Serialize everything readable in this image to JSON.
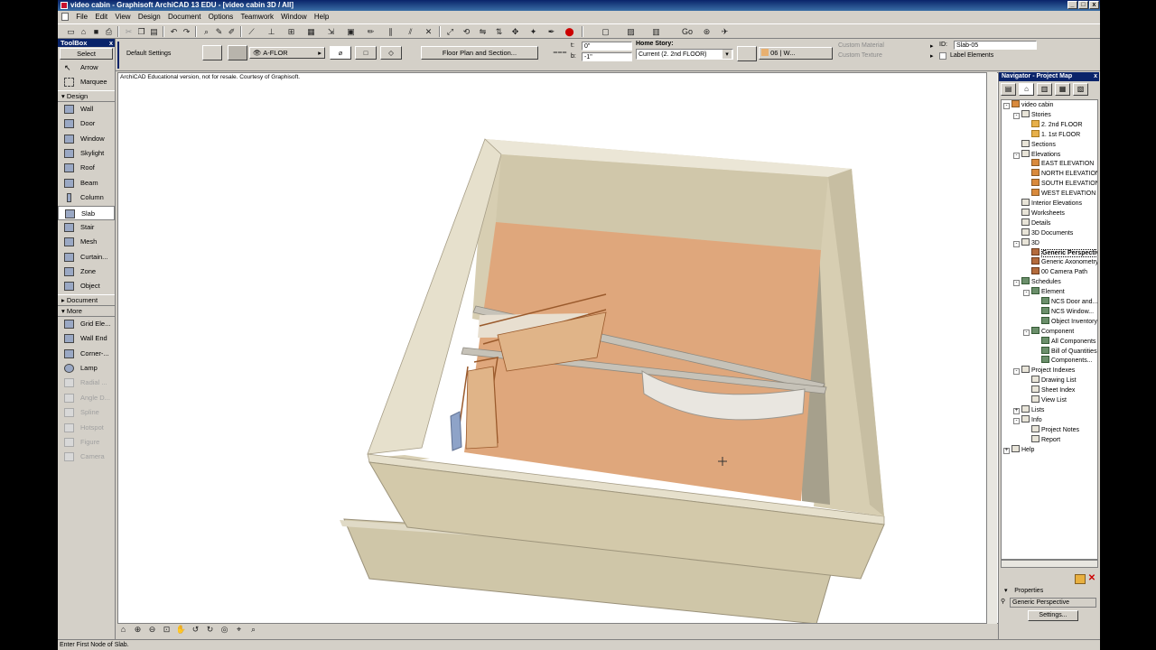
{
  "window": {
    "title": "video cabin - Graphisoft ArchiCAD 13 EDU - [video cabin 3D / All]",
    "min_btn": "_",
    "max_btn": "□",
    "close_btn": "x"
  },
  "menu": [
    "File",
    "Edit",
    "View",
    "Design",
    "Document",
    "Options",
    "Teamwork",
    "Window",
    "Help"
  ],
  "toolbar": {
    "go_label": "Go"
  },
  "infobox": {
    "default_settings": "Default Settings",
    "layer": "A-FLOR",
    "floor_plan_button": "Floor Plan and Section...",
    "t_label": "t:",
    "t_value": "0\"",
    "b_label": "b:",
    "b_value": "-1\"",
    "home_story_label": "Home Story:",
    "home_story_value": "Current (2. 2nd FLOOR)",
    "material": "06 | W...",
    "custom_material": "Custom Material",
    "custom_texture": "Custom Texture",
    "id_label": "ID:",
    "id_value": "Slab-05",
    "label_elements": "Label Elements"
  },
  "toolbox": {
    "title": "ToolBox",
    "select": "Select",
    "items_top": [
      "Arrow",
      "Marquee"
    ],
    "design_head": "Design",
    "design_items": [
      "Wall",
      "Door",
      "Window",
      "Skylight",
      "Roof",
      "Beam",
      "Column",
      "Slab",
      "Stair",
      "Mesh",
      "Curtain...",
      "Zone",
      "Object"
    ],
    "selected_item": "Slab",
    "document_head": "Document",
    "more_head": "More",
    "more_items": [
      "Grid Ele...",
      "Wall End",
      "Corner-...",
      "Lamp"
    ],
    "disabled_items": [
      "Radial ...",
      "Angle D...",
      "Spline",
      "Hotspot",
      "Figure",
      "Camera"
    ]
  },
  "view": {
    "note": "ArchiCAD Educational version, not for resale. Courtesy of Graphisoft."
  },
  "status": "Enter First Node of Slab.",
  "navigator": {
    "title": "Navigator - Project Map",
    "tree": [
      {
        "label": "video cabin",
        "level": 0,
        "exp": "-",
        "icon": "house"
      },
      {
        "label": "Stories",
        "level": 1,
        "exp": "-",
        "icon": "doc"
      },
      {
        "label": "2. 2nd FLOOR",
        "level": 2,
        "exp": "",
        "icon": "folder"
      },
      {
        "label": "1. 1st FLOOR",
        "level": 2,
        "exp": "",
        "icon": "folder"
      },
      {
        "label": "Sections",
        "level": 1,
        "exp": "",
        "icon": "doc"
      },
      {
        "label": "Elevations",
        "level": 1,
        "exp": "-",
        "icon": "doc"
      },
      {
        "label": "EAST ELEVATION",
        "level": 2,
        "exp": "",
        "icon": "house"
      },
      {
        "label": "NORTH ELEVATION",
        "level": 2,
        "exp": "",
        "icon": "house"
      },
      {
        "label": "SOUTH ELEVATION",
        "level": 2,
        "exp": "",
        "icon": "house"
      },
      {
        "label": "WEST ELEVATION",
        "level": 2,
        "exp": "",
        "icon": "house"
      },
      {
        "label": "Interior Elevations",
        "level": 1,
        "exp": "",
        "icon": "doc"
      },
      {
        "label": "Worksheets",
        "level": 1,
        "exp": "",
        "icon": "doc"
      },
      {
        "label": "Details",
        "level": 1,
        "exp": "",
        "icon": "doc"
      },
      {
        "label": "3D Documents",
        "level": 1,
        "exp": "",
        "icon": "doc"
      },
      {
        "label": "3D",
        "level": 1,
        "exp": "-",
        "icon": "doc"
      },
      {
        "label": "Generic Perspective",
        "level": 2,
        "exp": "",
        "icon": "persp",
        "selected": true
      },
      {
        "label": "Generic Axonometry",
        "level": 2,
        "exp": "",
        "icon": "persp"
      },
      {
        "label": "00 Camera Path",
        "level": 2,
        "exp": "",
        "icon": "persp"
      },
      {
        "label": "Schedules",
        "level": 1,
        "exp": "-",
        "icon": "sched"
      },
      {
        "label": "Element",
        "level": 2,
        "exp": "-",
        "icon": "sched"
      },
      {
        "label": "NCS Door and...",
        "level": 3,
        "exp": "",
        "icon": "sched"
      },
      {
        "label": "NCS Window...",
        "level": 3,
        "exp": "",
        "icon": "sched"
      },
      {
        "label": "Object Inventory",
        "level": 3,
        "exp": "",
        "icon": "sched"
      },
      {
        "label": "Component",
        "level": 2,
        "exp": "-",
        "icon": "sched"
      },
      {
        "label": "All Components",
        "level": 3,
        "exp": "",
        "icon": "sched"
      },
      {
        "label": "Bill of Quantities",
        "level": 3,
        "exp": "",
        "icon": "sched"
      },
      {
        "label": "Components...",
        "level": 3,
        "exp": "",
        "icon": "sched"
      },
      {
        "label": "Project Indexes",
        "level": 1,
        "exp": "-",
        "icon": "doc"
      },
      {
        "label": "Drawing List",
        "level": 2,
        "exp": "",
        "icon": "doc"
      },
      {
        "label": "Sheet Index",
        "level": 2,
        "exp": "",
        "icon": "doc"
      },
      {
        "label": "View List",
        "level": 2,
        "exp": "",
        "icon": "doc"
      },
      {
        "label": "Lists",
        "level": 1,
        "exp": "+",
        "icon": "doc"
      },
      {
        "label": "Info",
        "level": 1,
        "exp": "-",
        "icon": "doc"
      },
      {
        "label": "Project Notes",
        "level": 2,
        "exp": "",
        "icon": "doc"
      },
      {
        "label": "Report",
        "level": 2,
        "exp": "",
        "icon": "doc"
      },
      {
        "label": "Help",
        "level": 0,
        "exp": "+",
        "icon": "doc"
      }
    ],
    "properties_label": "Properties",
    "properties_value": "Generic Perspective",
    "settings_button": "Settings..."
  }
}
